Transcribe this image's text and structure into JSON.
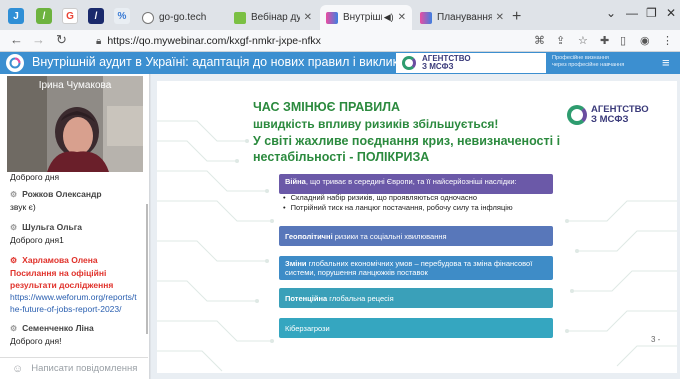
{
  "browser": {
    "tabs": [
      {
        "title": "go-go.tech",
        "active": false
      },
      {
        "title": "Вебінар дуже",
        "active": false
      },
      {
        "title": "Внутрішні",
        "active": true
      },
      {
        "title": "Планування і",
        "active": false
      }
    ],
    "url": "https://qo.mywebinar.com/kxgf-nmkr-jxpe-nfkx"
  },
  "webinar": {
    "title": "Внутрішній аудит в Україні: адаптація до нових правил і викликів ...",
    "banner_brand_line1": "АГЕНТСТВО",
    "banner_brand_line2": "З МСФЗ",
    "promo_line1": "Професійне визнання",
    "promo_line2": "через професійне навчання"
  },
  "video": {
    "presenter_name": "Ірина Чумакова"
  },
  "chat": {
    "messages": [
      {
        "name": "",
        "text": "Доброго дня"
      },
      {
        "name": "Рожков Олександр",
        "text": "звук є)"
      },
      {
        "name": "Шульга Ольга",
        "text": "Доброго дня1"
      },
      {
        "name": "Харламова Олена",
        "text": "Посилання на офіційні результати дослідження"
      },
      {
        "name": "",
        "text": "https://www.weforum.org/reports/the-future-of-jobs-report-2023/"
      },
      {
        "name": "Семенченко Ліна",
        "text": "Доброго дня!"
      }
    ],
    "compose_placeholder": "Написати повідомлення"
  },
  "slide": {
    "heading1": "ЧАС ЗМІНЮЄ ПРАВИЛА",
    "heading2": "швидкість впливу ризиків збільшується!",
    "heading3": "У світі жахливе поєднання криз, невизначеності і нестабільності - ПОЛІКРИЗА",
    "logo_line1": "АГЕНТСТВО",
    "logo_line2": "З МСФЗ",
    "box1_bold": "Війна",
    "box1_text": ", що триває в середині Європи, та її найсерйозніші наслідки:",
    "bullet1": "Складний набір ризиків, що проявляються одночасно",
    "bullet2": "Потрійний тиск на ланцюг постачання, робочу силу та інфляцію",
    "box2_bold": "Геополітичні",
    "box2_text": " ризики та соціальні хвилювання",
    "box3_bold": "Зміни",
    "box3_text": " глобальних економічних умов – перебудова та зміна фінансової системи, порушення ланцюжків поставок",
    "box4_bold": "Потенційна",
    "box4_text": " глобальна рецесія",
    "box5_text": "Кіберзагрози",
    "page_mark": "3 -"
  }
}
